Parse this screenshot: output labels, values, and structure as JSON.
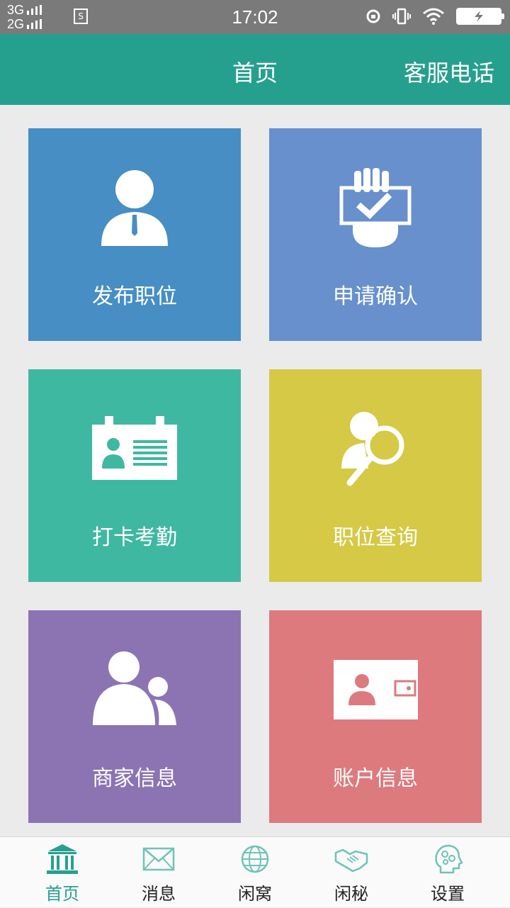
{
  "status_bar": {
    "network_top": "3G",
    "network_bottom": "2G",
    "sim_label": "S",
    "time": "17:02"
  },
  "header": {
    "title": "首页",
    "action": "客服电话",
    "color": "#26a08e"
  },
  "tiles": [
    {
      "label": "发布职位",
      "icon": "person-tie-icon",
      "color": "#468ec4"
    },
    {
      "label": "申请确认",
      "icon": "hand-check-icon",
      "color": "#6790cc"
    },
    {
      "label": "打卡考勤",
      "icon": "id-card-icon",
      "color": "#3fb8a1"
    },
    {
      "label": "职位查询",
      "icon": "person-search-icon",
      "color": "#d5c945"
    },
    {
      "label": "商家信息",
      "icon": "people-icon",
      "color": "#8c74b3"
    },
    {
      "label": "账户信息",
      "icon": "wallet-card-icon",
      "color": "#dc7a7e"
    }
  ],
  "tabs": [
    {
      "label": "首页",
      "icon": "bank-icon",
      "active": true
    },
    {
      "label": "消息",
      "icon": "envelope-icon",
      "active": false
    },
    {
      "label": "闲窝",
      "icon": "globe-icon",
      "active": false
    },
    {
      "label": "闲秘",
      "icon": "handshake-icon",
      "active": false
    },
    {
      "label": "设置",
      "icon": "head-gears-icon",
      "active": false
    }
  ]
}
